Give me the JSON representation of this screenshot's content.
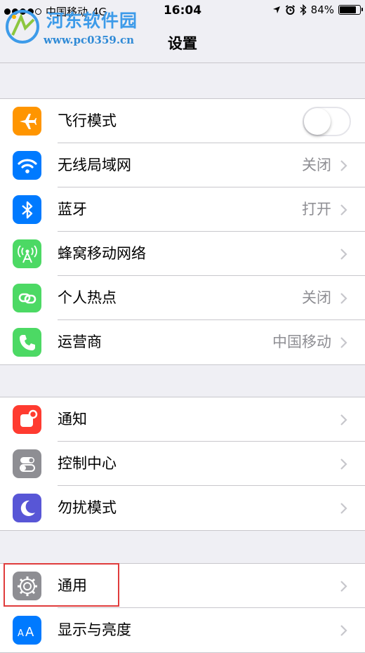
{
  "status_bar": {
    "carrier": "中国移动",
    "network": "4G",
    "time": "16:04",
    "battery_text": "84%",
    "battery_level": 0.84,
    "signal_bars_filled": 4,
    "signal_bars_total": 5
  },
  "watermark": {
    "title": "河东软件园",
    "url": "www.pc0359.cn"
  },
  "navbar": {
    "title": "设置"
  },
  "groups": [
    {
      "rows": [
        {
          "label": "飞行模式",
          "icon": "airplane-icon",
          "color": "#ff9500",
          "toggle": false
        },
        {
          "label": "无线局域网",
          "icon": "wifi-icon",
          "color": "#007aff",
          "value": "关闭"
        },
        {
          "label": "蓝牙",
          "icon": "bluetooth-icon",
          "color": "#007aff",
          "value": "打开"
        },
        {
          "label": "蜂窝移动网络",
          "icon": "cellular-antenna-icon",
          "color": "#4cd964",
          "value": ""
        },
        {
          "label": "个人热点",
          "icon": "hotspot-link-icon",
          "color": "#4cd964",
          "value": "关闭"
        },
        {
          "label": "运营商",
          "icon": "phone-icon",
          "color": "#4cd964",
          "value": "中国移动"
        }
      ]
    },
    {
      "rows": [
        {
          "label": "通知",
          "icon": "notifications-icon",
          "color": "#ff3b30"
        },
        {
          "label": "控制中心",
          "icon": "control-center-icon",
          "color": "#8e8e93"
        },
        {
          "label": "勿扰模式",
          "icon": "moon-icon",
          "color": "#5856d6"
        }
      ]
    },
    {
      "rows": [
        {
          "label": "通用",
          "icon": "gear-icon",
          "color": "#8e8e93",
          "highlighted": true
        },
        {
          "label": "显示与亮度",
          "icon": "text-size-icon",
          "color": "#007aff"
        }
      ]
    }
  ]
}
